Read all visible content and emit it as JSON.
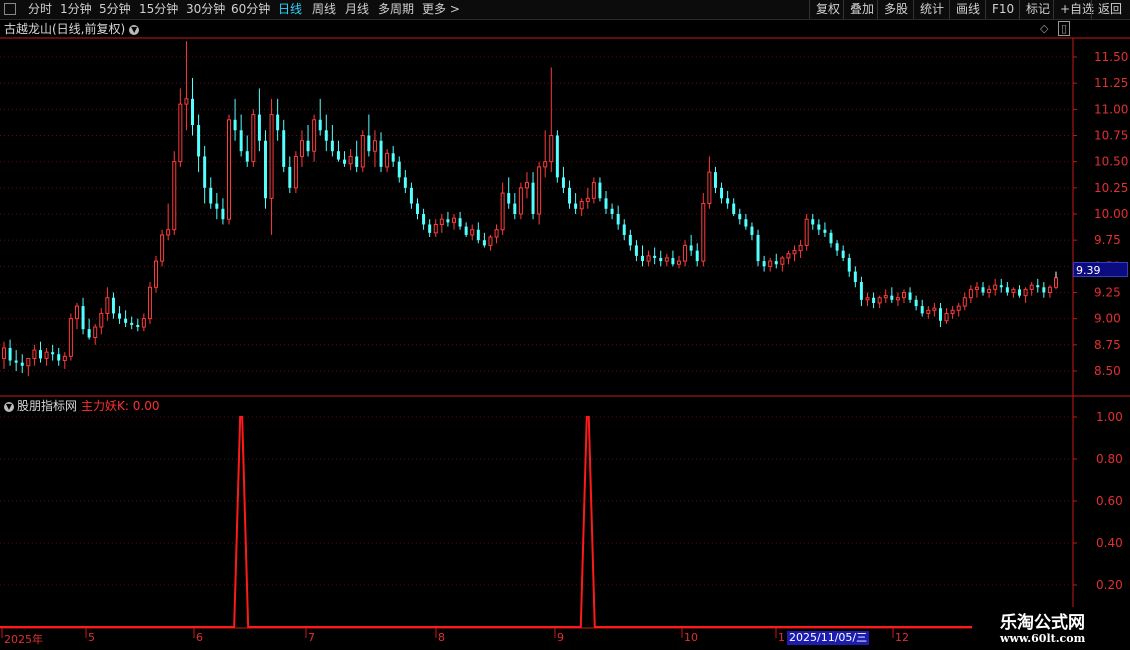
{
  "toolbar": {
    "left_items": [
      "分时",
      "1分钟",
      "5分钟",
      "15分钟",
      "30分钟",
      "60分钟",
      "日线",
      "周线",
      "月线",
      "多周期",
      "更多 >"
    ],
    "active_item": "日线",
    "right_items": [
      "复权",
      "叠加",
      "多股",
      "统计",
      "画线",
      "F10",
      "标记",
      "+自选",
      "返回"
    ]
  },
  "chart_header": {
    "title": "古越龙山(日线,前复权)"
  },
  "indicator_header": {
    "name": "股朋指标网",
    "value_text": "主力妖K: 0.00"
  },
  "price_axis": [
    "11.50",
    "11.25",
    "11.00",
    "10.75",
    "10.50",
    "10.25",
    "10.00",
    "9.75",
    "9.50",
    "9.25",
    "9.00",
    "8.75",
    "8.50"
  ],
  "current_price_tag": "9.39",
  "indicator_axis": [
    "1.00",
    "0.80",
    "0.60",
    "0.40",
    "0.20"
  ],
  "time_axis": [
    "2025年",
    "5",
    "6",
    "7",
    "8",
    "9",
    "10",
    "1",
    "12"
  ],
  "selected_date": "2025/11/05/三",
  "watermark": {
    "brand": "乐淘公式网",
    "url": "www.60lt.com"
  },
  "colors": {
    "up": "#ff3b3b",
    "down": "#54ffff",
    "axis": "#c41818",
    "active": "#2fd2ff",
    "grid": "#5a1010"
  },
  "chart_data": [
    {
      "type": "candlestick",
      "title": "古越龙山(日线,前复权)",
      "ylim": [
        8.4,
        11.7
      ],
      "ohlc": [
        [
          8.62,
          8.78,
          8.52,
          8.72
        ],
        [
          8.72,
          8.8,
          8.55,
          8.6
        ],
        [
          8.6,
          8.7,
          8.5,
          8.58
        ],
        [
          8.58,
          8.66,
          8.48,
          8.55
        ],
        [
          8.55,
          8.62,
          8.45,
          8.62
        ],
        [
          8.62,
          8.75,
          8.55,
          8.7
        ],
        [
          8.7,
          8.78,
          8.58,
          8.62
        ],
        [
          8.62,
          8.72,
          8.55,
          8.68
        ],
        [
          8.68,
          8.75,
          8.6,
          8.66
        ],
        [
          8.66,
          8.72,
          8.55,
          8.6
        ],
        [
          8.6,
          8.68,
          8.52,
          8.64
        ],
        [
          8.64,
          9.05,
          8.6,
          9.0
        ],
        [
          9.0,
          9.15,
          8.9,
          9.12
        ],
        [
          9.12,
          9.2,
          8.85,
          8.9
        ],
        [
          8.9,
          9.0,
          8.8,
          8.82
        ],
        [
          8.82,
          8.95,
          8.75,
          8.92
        ],
        [
          8.92,
          9.1,
          8.85,
          9.05
        ],
        [
          9.05,
          9.3,
          8.98,
          9.2
        ],
        [
          9.2,
          9.25,
          9.0,
          9.05
        ],
        [
          9.05,
          9.12,
          8.95,
          9.0
        ],
        [
          9.0,
          9.08,
          8.92,
          8.96
        ],
        [
          8.96,
          9.02,
          8.9,
          8.94
        ],
        [
          8.94,
          9.0,
          8.88,
          8.92
        ],
        [
          8.92,
          9.05,
          8.88,
          9.0
        ],
        [
          9.0,
          9.35,
          8.95,
          9.3
        ],
        [
          9.3,
          9.6,
          9.25,
          9.55
        ],
        [
          9.55,
          9.85,
          9.5,
          9.8
        ],
        [
          9.8,
          10.1,
          9.75,
          9.85
        ],
        [
          9.85,
          10.6,
          9.8,
          10.5
        ],
        [
          10.5,
          11.2,
          10.45,
          11.05
        ],
        [
          11.05,
          11.65,
          10.8,
          11.1
        ],
        [
          11.1,
          11.3,
          10.75,
          10.85
        ],
        [
          10.85,
          10.95,
          10.4,
          10.55
        ],
        [
          10.55,
          10.65,
          10.1,
          10.25
        ],
        [
          10.25,
          10.35,
          10.05,
          10.1
        ],
        [
          10.1,
          10.2,
          9.95,
          10.05
        ],
        [
          10.05,
          10.15,
          9.9,
          9.95
        ],
        [
          9.95,
          10.95,
          9.9,
          10.9
        ],
        [
          10.9,
          11.1,
          10.7,
          10.8
        ],
        [
          10.8,
          10.95,
          10.55,
          10.6
        ],
        [
          10.6,
          10.75,
          10.45,
          10.5
        ],
        [
          10.5,
          11.0,
          10.45,
          10.95
        ],
        [
          10.95,
          11.2,
          10.6,
          10.7
        ],
        [
          10.7,
          10.8,
          10.05,
          10.15
        ],
        [
          10.15,
          11.1,
          9.8,
          10.95
        ],
        [
          10.95,
          11.1,
          10.7,
          10.8
        ],
        [
          10.8,
          10.9,
          10.4,
          10.45
        ],
        [
          10.45,
          10.55,
          10.2,
          10.25
        ],
        [
          10.25,
          10.6,
          10.2,
          10.55
        ],
        [
          10.55,
          10.8,
          10.45,
          10.7
        ],
        [
          10.7,
          10.85,
          10.55,
          10.6
        ],
        [
          10.6,
          10.95,
          10.5,
          10.9
        ],
        [
          10.9,
          11.1,
          10.75,
          10.8
        ],
        [
          10.8,
          10.95,
          10.6,
          10.7
        ],
        [
          10.7,
          10.85,
          10.55,
          10.6
        ],
        [
          10.6,
          10.7,
          10.5,
          10.52
        ],
        [
          10.52,
          10.6,
          10.45,
          10.48
        ],
        [
          10.48,
          10.62,
          10.42,
          10.55
        ],
        [
          10.55,
          10.7,
          10.4,
          10.45
        ],
        [
          10.45,
          10.8,
          10.4,
          10.75
        ],
        [
          10.75,
          10.95,
          10.55,
          10.6
        ],
        [
          10.6,
          10.8,
          10.45,
          10.7
        ],
        [
          10.7,
          10.78,
          10.4,
          10.45
        ],
        [
          10.45,
          10.62,
          10.4,
          10.58
        ],
        [
          10.58,
          10.65,
          10.45,
          10.5
        ],
        [
          10.5,
          10.55,
          10.3,
          10.35
        ],
        [
          10.35,
          10.42,
          10.2,
          10.25
        ],
        [
          10.25,
          10.3,
          10.05,
          10.1
        ],
        [
          10.1,
          10.15,
          9.95,
          10.0
        ],
        [
          10.0,
          10.05,
          9.85,
          9.9
        ],
        [
          9.9,
          9.95,
          9.78,
          9.82
        ],
        [
          9.82,
          9.95,
          9.78,
          9.9
        ],
        [
          9.9,
          10.0,
          9.82,
          9.95
        ],
        [
          9.95,
          10.02,
          9.88,
          9.92
        ],
        [
          9.92,
          10.0,
          9.85,
          9.96
        ],
        [
          9.96,
          10.02,
          9.85,
          9.88
        ],
        [
          9.88,
          9.92,
          9.78,
          9.8
        ],
        [
          9.8,
          9.9,
          9.75,
          9.85
        ],
        [
          9.85,
          9.92,
          9.72,
          9.75
        ],
        [
          9.75,
          9.82,
          9.68,
          9.7
        ],
        [
          9.7,
          9.8,
          9.65,
          9.78
        ],
        [
          9.78,
          9.9,
          9.72,
          9.85
        ],
        [
          9.85,
          10.3,
          9.8,
          10.2
        ],
        [
          10.2,
          10.35,
          10.05,
          10.1
        ],
        [
          10.1,
          10.2,
          9.95,
          10.0
        ],
        [
          10.0,
          10.3,
          9.95,
          10.25
        ],
        [
          10.25,
          10.4,
          10.15,
          10.3
        ],
        [
          10.3,
          10.4,
          9.95,
          10.0
        ],
        [
          10.0,
          10.5,
          9.9,
          10.45
        ],
        [
          10.45,
          10.8,
          10.35,
          10.5
        ],
        [
          10.5,
          11.4,
          10.4,
          10.75
        ],
        [
          10.75,
          10.8,
          10.3,
          10.35
        ],
        [
          10.35,
          10.45,
          10.2,
          10.25
        ],
        [
          10.25,
          10.32,
          10.05,
          10.1
        ],
        [
          10.1,
          10.2,
          10.0,
          10.05
        ],
        [
          10.05,
          10.15,
          9.98,
          10.12
        ],
        [
          10.12,
          10.25,
          10.05,
          10.15
        ],
        [
          10.15,
          10.35,
          10.1,
          10.3
        ],
        [
          10.3,
          10.35,
          10.12,
          10.15
        ],
        [
          10.15,
          10.22,
          10.0,
          10.05
        ],
        [
          10.05,
          10.1,
          9.95,
          10.0
        ],
        [
          10.0,
          10.08,
          9.85,
          9.9
        ],
        [
          9.9,
          9.95,
          9.75,
          9.8
        ],
        [
          9.8,
          9.85,
          9.65,
          9.7
        ],
        [
          9.7,
          9.75,
          9.55,
          9.6
        ],
        [
          9.6,
          9.7,
          9.5,
          9.55
        ],
        [
          9.55,
          9.65,
          9.5,
          9.6
        ],
        [
          9.6,
          9.68,
          9.52,
          9.58
        ],
        [
          9.58,
          9.65,
          9.5,
          9.55
        ],
        [
          9.55,
          9.62,
          9.5,
          9.58
        ],
        [
          9.58,
          9.65,
          9.5,
          9.52
        ],
        [
          9.52,
          9.6,
          9.48,
          9.55
        ],
        [
          9.55,
          9.75,
          9.5,
          9.7
        ],
        [
          9.7,
          9.8,
          9.6,
          9.65
        ],
        [
          9.65,
          9.72,
          9.5,
          9.55
        ],
        [
          9.55,
          10.2,
          9.5,
          10.1
        ],
        [
          10.1,
          10.55,
          10.05,
          10.4
        ],
        [
          10.4,
          10.45,
          10.2,
          10.25
        ],
        [
          10.25,
          10.3,
          10.1,
          10.15
        ],
        [
          10.15,
          10.22,
          10.05,
          10.1
        ],
        [
          10.1,
          10.15,
          9.98,
          10.0
        ],
        [
          10.0,
          10.05,
          9.9,
          9.95
        ],
        [
          9.95,
          10.0,
          9.85,
          9.88
        ],
        [
          9.88,
          9.92,
          9.75,
          9.8
        ],
        [
          9.8,
          9.85,
          9.5,
          9.55
        ],
        [
          9.55,
          9.6,
          9.45,
          9.5
        ],
        [
          9.5,
          9.58,
          9.45,
          9.55
        ],
        [
          9.55,
          9.62,
          9.48,
          9.52
        ],
        [
          9.52,
          9.6,
          9.45,
          9.58
        ],
        [
          9.58,
          9.65,
          9.52,
          9.62
        ],
        [
          9.62,
          9.7,
          9.55,
          9.65
        ],
        [
          9.65,
          9.75,
          9.58,
          9.7
        ],
        [
          9.7,
          10.0,
          9.65,
          9.95
        ],
        [
          9.95,
          10.0,
          9.85,
          9.9
        ],
        [
          9.9,
          9.95,
          9.8,
          9.85
        ],
        [
          9.85,
          9.92,
          9.78,
          9.82
        ],
        [
          9.82,
          9.85,
          9.68,
          9.72
        ],
        [
          9.72,
          9.75,
          9.6,
          9.65
        ],
        [
          9.65,
          9.7,
          9.55,
          9.58
        ],
        [
          9.58,
          9.62,
          9.4,
          9.45
        ],
        [
          9.45,
          9.5,
          9.3,
          9.35
        ],
        [
          9.35,
          9.4,
          9.12,
          9.18
        ],
        [
          9.18,
          9.25,
          9.12,
          9.2
        ],
        [
          9.2,
          9.25,
          9.1,
          9.15
        ],
        [
          9.15,
          9.22,
          9.1,
          9.2
        ],
        [
          9.2,
          9.28,
          9.15,
          9.22
        ],
        [
          9.22,
          9.3,
          9.15,
          9.18
        ],
        [
          9.18,
          9.25,
          9.12,
          9.2
        ],
        [
          9.2,
          9.28,
          9.15,
          9.25
        ],
        [
          9.25,
          9.3,
          9.15,
          9.18
        ],
        [
          9.18,
          9.22,
          9.08,
          9.12
        ],
        [
          9.12,
          9.18,
          9.02,
          9.05
        ],
        [
          9.05,
          9.12,
          9.0,
          9.08
        ],
        [
          9.08,
          9.15,
          9.02,
          9.1
        ],
        [
          9.1,
          9.15,
          8.92,
          8.98
        ],
        [
          8.98,
          9.1,
          8.95,
          9.05
        ],
        [
          9.05,
          9.12,
          9.0,
          9.08
        ],
        [
          9.08,
          9.15,
          9.02,
          9.12
        ],
        [
          9.12,
          9.25,
          9.08,
          9.2
        ],
        [
          9.2,
          9.32,
          9.15,
          9.28
        ],
        [
          9.28,
          9.35,
          9.2,
          9.3
        ],
        [
          9.3,
          9.35,
          9.22,
          9.25
        ],
        [
          9.25,
          9.32,
          9.2,
          9.28
        ],
        [
          9.28,
          9.38,
          9.22,
          9.32
        ],
        [
          9.32,
          9.38,
          9.25,
          9.3
        ],
        [
          9.3,
          9.35,
          9.22,
          9.25
        ],
        [
          9.25,
          9.3,
          9.2,
          9.28
        ],
        [
          9.28,
          9.32,
          9.2,
          9.22
        ],
        [
          9.22,
          9.3,
          9.15,
          9.28
        ],
        [
          9.28,
          9.35,
          9.22,
          9.32
        ],
        [
          9.32,
          9.38,
          9.25,
          9.3
        ],
        [
          9.3,
          9.35,
          9.2,
          9.25
        ],
        [
          9.25,
          9.32,
          9.2,
          9.3
        ],
        [
          9.3,
          9.42,
          9.28,
          9.39
        ]
      ]
    },
    {
      "type": "line",
      "title": "主力妖K",
      "ylim": [
        0,
        1.05
      ],
      "series": [
        {
          "name": "主力妖K",
          "spikes_at_index": [
            39,
            96
          ],
          "values_note_shape": "0 except 1 at spikes"
        }
      ]
    }
  ]
}
